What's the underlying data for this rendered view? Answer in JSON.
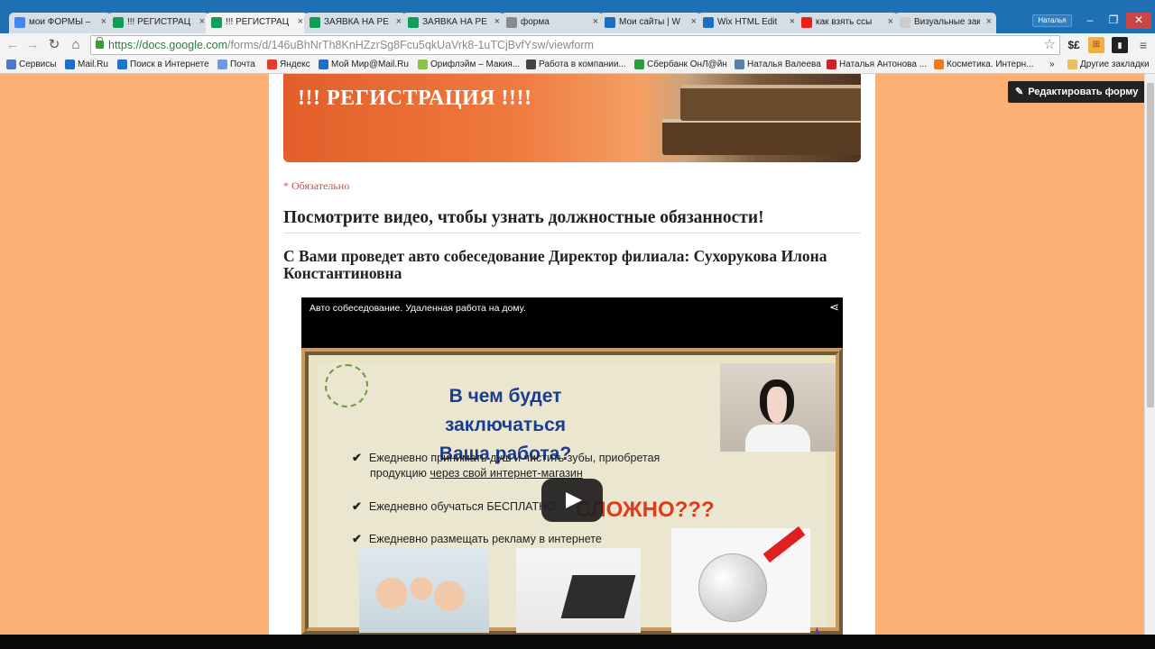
{
  "browser": {
    "tabs": [
      {
        "label": "мои ФОРМЫ – ",
        "color": "#4285f4",
        "active": false
      },
      {
        "label": "!!! РЕГИСТРАЦ",
        "color": "#0f9d58",
        "active": false
      },
      {
        "label": "!!! РЕГИСТРАЦ",
        "color": "#0f9d58",
        "active": true
      },
      {
        "label": "ЗАЯВКА НА РЕ",
        "color": "#0f9d58",
        "active": false
      },
      {
        "label": "ЗАЯВКА НА РЕ",
        "color": "#0f9d58",
        "active": false
      },
      {
        "label": "форма",
        "color": "#8a8a8a",
        "active": false
      },
      {
        "label": "Мои сайты | W",
        "color": "#1b6ec2",
        "active": false
      },
      {
        "label": "Wix HTML Edit",
        "color": "#1b6ec2",
        "active": false
      },
      {
        "label": "как взять ссы",
        "color": "#e62117",
        "active": false
      },
      {
        "label": "Визуальные закл",
        "color": "#cccccc",
        "active": false
      }
    ],
    "profile_name": "Наталья",
    "url_host": "https://docs.google.com",
    "url_path": "/forms/d/146uBhNrTh8KnHZzrSg8Fcu5qkUaVrk8-1uTCjBvfYsw/viewform",
    "bookmarks": [
      {
        "label": "Сервисы",
        "color": "#4a7ac9"
      },
      {
        "label": "Mail.Ru",
        "color": "#1f6fc9"
      },
      {
        "label": "Поиск в Интернете",
        "color": "#1e73c8"
      },
      {
        "label": "Почта",
        "color": "#6a9be0"
      },
      {
        "label": "Яндекс",
        "color": "#e33b2e"
      },
      {
        "label": "Мой Мир@Mail.Ru",
        "color": "#1f6fc9"
      },
      {
        "label": "Орифлэйм – Макия...",
        "color": "#8bc34a"
      },
      {
        "label": "Работа в компании...",
        "color": "#444444"
      },
      {
        "label": "Сбербанк ОнЛ@йн",
        "color": "#2e9e3c"
      },
      {
        "label": "Наталья Валеева",
        "color": "#5b7fa6"
      },
      {
        "label": "Наталья Антонова ...",
        "color": "#c62828"
      },
      {
        "label": "Косметика. Интерн...",
        "color": "#f07a1a"
      }
    ],
    "more_bookmarks": "»",
    "other_bookmarks": "Другие закладки"
  },
  "page": {
    "edit_button": "Редактировать форму",
    "header_title": "!!! РЕГИСТРАЦИЯ !!!!",
    "required_note": "* Обязательно",
    "section_title": "Посмотрите видео, чтобы узнать должностные обязанности!",
    "question": "С Вами проведет авто собеседование Директор филиала: Сухорукова Илона Константиновна",
    "video": {
      "title": "Авто собеседование. Удаленная работа на дому.",
      "slide_title_line1": "В чем будет заключаться",
      "slide_title_line2": "Ваша работа?",
      "bullet1_line1": "Ежедневно принимать душ и чистить зубы, приобретая",
      "bullet1_line2_prefix": "продукцию ",
      "bullet1_line2_link": "через свой интернет-магазин",
      "bullet2": "Ежедневно обучаться БЕСПЛАТНО",
      "bullet3": "Ежедневно размещать рекламу в интернете",
      "accent_text": "СЛОЖНО???",
      "check_mark": "✔"
    }
  },
  "colors": {
    "page_background": "#fdb074",
    "banner_orange": "#e35e2a",
    "required_red": "#c0504d",
    "slide_title_blue": "#1a3d8f",
    "accent_red": "#e03a1c"
  }
}
